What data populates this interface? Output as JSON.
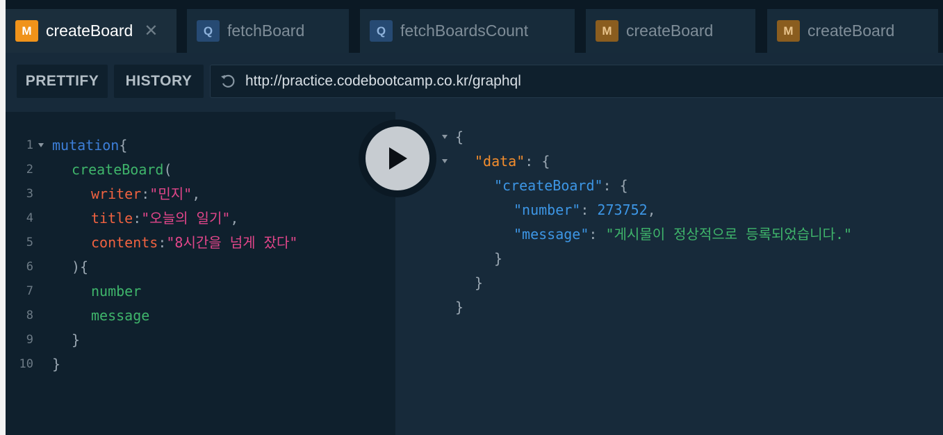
{
  "tabs": [
    {
      "badge": "M",
      "label": "createBoard",
      "close": "✕"
    },
    {
      "badge": "Q",
      "label": "fetchBoard"
    },
    {
      "badge": "Q",
      "label": "fetchBoardsCount"
    },
    {
      "badge": "M",
      "label": "createBoard"
    },
    {
      "badge": "M",
      "label": "createBoard"
    }
  ],
  "toolbar": {
    "prettify_label": "PRETTIFY",
    "history_label": "HISTORY",
    "url": "http://practice.codebootcamp.co.kr/graphql"
  },
  "editor": {
    "line_numbers": [
      "1",
      "2",
      "3",
      "4",
      "5",
      "6",
      "7",
      "8",
      "9",
      "10"
    ],
    "lines": {
      "l1": {
        "kw": "mutation",
        "p": "{"
      },
      "l2": {
        "fn": "createBoard",
        "p": "("
      },
      "l3": {
        "arg": "writer",
        "colon": ":",
        "str": "\"민지\"",
        "comma": ","
      },
      "l4": {
        "arg": "title",
        "colon": ":",
        "str": "\"오늘의 일기\"",
        "comma": ","
      },
      "l5": {
        "arg": "contents",
        "colon": ":",
        "str": "\"8시간을 넘게 잤다\""
      },
      "l6": {
        "p": "){"
      },
      "l7": {
        "field": "number"
      },
      "l8": {
        "field": "message"
      },
      "l9": {
        "p": "}"
      },
      "l10": {
        "p": "}"
      }
    }
  },
  "result": {
    "open1": "{",
    "data_key": "\"data\"",
    "colon_brace": ": {",
    "create_key": "\"createBoard\"",
    "number_key": "\"number\"",
    "number_colon": ": ",
    "number_value": "273752",
    "comma": ",",
    "message_key": "\"message\"",
    "message_colon": ": ",
    "message_value": "\"게시물이 정상적으로 등록되었습니다.\"",
    "close_a": "}",
    "close_b": "}",
    "close_c": "}"
  },
  "colors": {
    "background": "#0f202d",
    "result_background": "#172a3a",
    "mutation_badge": "#f0931a",
    "query_badge": "#264a73"
  }
}
